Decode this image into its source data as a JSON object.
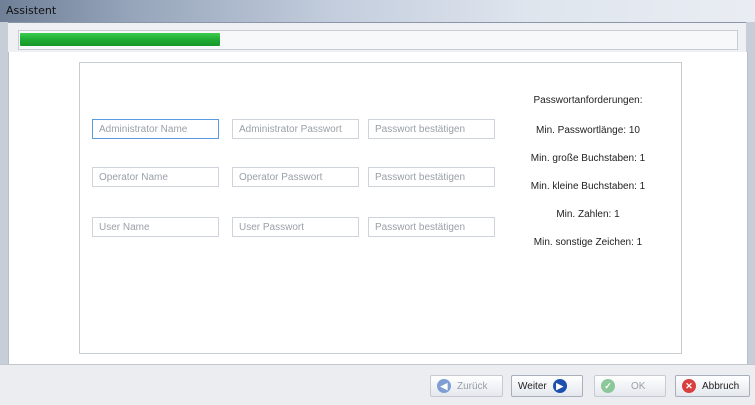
{
  "window": {
    "title": "Assistent"
  },
  "progress": {
    "value_fraction": 0.28,
    "color": "#22b33a"
  },
  "rows": [
    {
      "name_placeholder": "Administrator Name",
      "password_placeholder": "Administrator Passwort",
      "confirm_placeholder": "Passwort bestätigen"
    },
    {
      "name_placeholder": "Operator Name",
      "password_placeholder": "Operator Passwort",
      "confirm_placeholder": "Passwort bestätigen"
    },
    {
      "name_placeholder": "User Name",
      "password_placeholder": "User Passwort",
      "confirm_placeholder": "Passwort bestätigen"
    }
  ],
  "requirements": {
    "heading": "Passwortanforderungen:",
    "items": [
      "Min. Passwortlänge: 10",
      "Min. große Buchstaben: 1",
      "Min. kleine Buchstaben: 1",
      "Min. Zahlen: 1",
      "Min. sonstige Zeichen: 1"
    ]
  },
  "buttons": {
    "back": {
      "label": "Zurück",
      "icon": "arrow-left-circle-icon"
    },
    "next": {
      "label": "Weiter",
      "icon": "arrow-right-circle-icon"
    },
    "ok": {
      "label": "OK",
      "icon": "checkmark-circle-icon"
    },
    "cancel": {
      "label": "Abbruch",
      "icon": "x-circle-icon"
    }
  }
}
